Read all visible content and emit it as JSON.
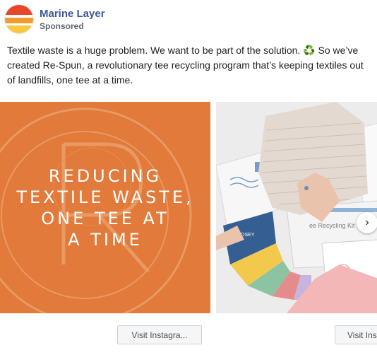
{
  "header": {
    "page_name": "Marine Layer",
    "sponsored": "Sponsored",
    "avatar_colors": [
      "#e8462a",
      "#f29a32",
      "#f6c940"
    ]
  },
  "post": {
    "text_before": "Textile waste is a huge problem. We want to be part of the solution. ",
    "recycle_icon": "♻️",
    "text_after": " So we’ve created Re-Spun, a revolutionary tee recycling program that’s keeping textiles out of landfills, one tee at a time."
  },
  "carousel": {
    "card1": {
      "background": "#e17a3a",
      "lines": [
        "REDUCING",
        "TEXTILE WASTE,",
        "ONE TEE AT",
        "A TIME"
      ],
      "cta": "Visit Instagra..."
    },
    "card2": {
      "kit_label": "ee Recycling Kit",
      "swatch_label": "ROSEY",
      "cta": "Visit Ins"
    },
    "next_icon": "chevron-right-icon"
  }
}
